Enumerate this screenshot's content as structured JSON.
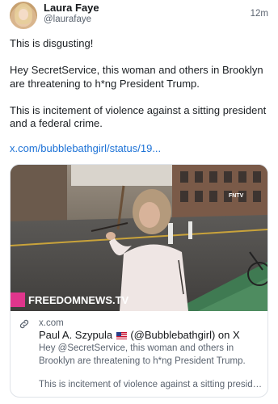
{
  "author": {
    "name": "Laura Faye",
    "handle": "@laurafaye",
    "time": "12m"
  },
  "post": {
    "paragraphs": [
      "This is disgusting!",
      "Hey SecretService, this woman and others in Brooklyn are threatening to h*ng President Trump.",
      "This is incitement of violence against a sitting president and a federal crime."
    ],
    "link_text": "x.com/bubblebathgirl/status/19..."
  },
  "card": {
    "watermark_brand": "FREEDOMNEWS.TV",
    "watermark_tag": "FNTV",
    "domain": "x.com",
    "title_before_flag": "Paul A. Szypula",
    "title_after_flag": "(@Bubblebathgirl) on X",
    "description": "Hey @SecretService, this woman and others in Brooklyn are threatening to h*ng President Trump.",
    "description_2": "This is incitement of violence against a sitting preside..."
  },
  "colors": {
    "link": "#1d72d6",
    "brand_pink": "#e0358c",
    "text": "#14171a",
    "muted": "#5b6470"
  }
}
